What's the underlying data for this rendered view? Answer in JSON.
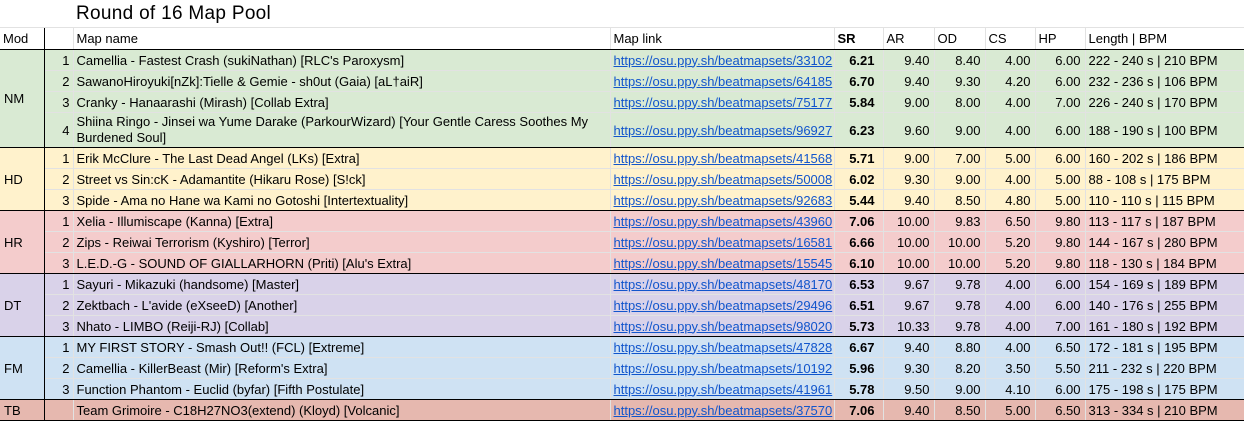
{
  "title": "Round of 16 Map Pool",
  "headers": {
    "mod": "Mod",
    "map_name": "Map name",
    "map_link": "Map link",
    "sr": "SR",
    "ar": "AR",
    "od": "OD",
    "cs": "CS",
    "hp": "HP",
    "length_bpm": "Length | BPM"
  },
  "colors": {
    "NM": "#d9ead3",
    "HD": "#fff2cc",
    "HR": "#f4cccc",
    "DT": "#d9d2e9",
    "FM": "#cfe2f3",
    "TB": "#e6b8af"
  },
  "groups": [
    {
      "mod": "NM",
      "rows": [
        {
          "num": "1",
          "name": "Camellia - Fastest Crash (sukiNathan) [RLC's Paroxysm]",
          "link": "https://osu.ppy.sh/beatmapsets/33102",
          "sr": "6.21",
          "ar": "9.40",
          "od": "8.40",
          "cs": "4.00",
          "hp": "6.00",
          "len": "222 - 240 s | 210 BPM"
        },
        {
          "num": "2",
          "name": "SawanoHiroyuki[nZk]:Tielle & Gemie - sh0ut (Gaia) [aL†aiR]",
          "link": "https://osu.ppy.sh/beatmapsets/64185",
          "sr": "6.70",
          "ar": "9.40",
          "od": "9.30",
          "cs": "4.20",
          "hp": "6.00",
          "len": "232 - 236 s | 106 BPM"
        },
        {
          "num": "3",
          "name": "Cranky - Hanaarashi (Mirash) [Collab Extra]",
          "link": "https://osu.ppy.sh/beatmapsets/75177",
          "sr": "5.84",
          "ar": "9.00",
          "od": "8.00",
          "cs": "4.00",
          "hp": "7.00",
          "len": "226 - 240 s | 170 BPM"
        },
        {
          "num": "4",
          "name": "Shiina Ringo - Jinsei wa Yume Darake (ParkourWizard) [Your Gentle Caress Soothes My Burdened Soul]",
          "link": "https://osu.ppy.sh/beatmapsets/96927",
          "sr": "6.23",
          "ar": "9.60",
          "od": "9.00",
          "cs": "4.00",
          "hp": "6.00",
          "len": "188 - 190 s | 100 BPM",
          "tall": true
        }
      ]
    },
    {
      "mod": "HD",
      "rows": [
        {
          "num": "1",
          "name": "Erik McClure - The Last Dead Angel (LKs) [Extra]",
          "link": "https://osu.ppy.sh/beatmapsets/41568",
          "sr": "5.71",
          "ar": "9.00",
          "od": "7.00",
          "cs": "5.00",
          "hp": "6.00",
          "len": "160 - 202 s | 186 BPM"
        },
        {
          "num": "2",
          "name": "Street vs Sin:cK - Adamantite (Hikaru Rose) [S!ck]",
          "link": "https://osu.ppy.sh/beatmapsets/50008",
          "sr": "6.02",
          "ar": "9.30",
          "od": "9.00",
          "cs": "4.00",
          "hp": "5.00",
          "len": "88 - 108 s | 175 BPM"
        },
        {
          "num": "3",
          "name": "Spide - Ama no Hane wa Kami no Gotoshi [Intertextuality]",
          "link": "https://osu.ppy.sh/beatmapsets/92683",
          "sr": "5.44",
          "ar": "9.40",
          "od": "8.50",
          "cs": "4.80",
          "hp": "5.00",
          "len": "110 - 110 s | 115 BPM"
        }
      ]
    },
    {
      "mod": "HR",
      "rows": [
        {
          "num": "1",
          "name": "Xelia - Illumiscape (Kanna) [Extra]",
          "link": "https://osu.ppy.sh/beatmapsets/43960",
          "sr": "7.06",
          "ar": "10.00",
          "od": "9.83",
          "cs": "6.50",
          "hp": "9.80",
          "len": "113 - 117 s | 187 BPM"
        },
        {
          "num": "2",
          "name": "Zips - Reiwai Terrorism (Kyshiro) [Terror]",
          "link": "https://osu.ppy.sh/beatmapsets/16581",
          "sr": "6.66",
          "ar": "10.00",
          "od": "10.00",
          "cs": "5.20",
          "hp": "9.80",
          "len": "144 - 167 s | 280 BPM"
        },
        {
          "num": "3",
          "name": "L.E.D.-G - SOUND OF GIALLARHORN (Priti) [Alu's Extra]",
          "link": "https://osu.ppy.sh/beatmapsets/15545",
          "sr": "6.10",
          "ar": "10.00",
          "od": "10.00",
          "cs": "5.20",
          "hp": "9.80",
          "len": "118 - 130 s | 184 BPM"
        }
      ]
    },
    {
      "mod": "DT",
      "rows": [
        {
          "num": "1",
          "name": "Sayuri - Mikazuki (handsome) [Master]",
          "link": "https://osu.ppy.sh/beatmapsets/48170",
          "sr": "6.53",
          "ar": "9.67",
          "od": "9.78",
          "cs": "4.00",
          "hp": "6.00",
          "len": "154 - 169 s | 189 BPM"
        },
        {
          "num": "2",
          "name": "Zektbach - L'avide (eXseeD) [Another]",
          "link": "https://osu.ppy.sh/beatmapsets/29496",
          "sr": "6.51",
          "ar": "9.67",
          "od": "9.78",
          "cs": "4.00",
          "hp": "6.00",
          "len": "140 - 176 s | 255 BPM"
        },
        {
          "num": "3",
          "name": "Nhato - LIMBO (Reiji-RJ) [Collab]",
          "link": "https://osu.ppy.sh/beatmapsets/98020",
          "sr": "5.73",
          "ar": "10.33",
          "od": "9.78",
          "cs": "4.00",
          "hp": "7.00",
          "len": "161 - 180 s | 192 BPM"
        }
      ]
    },
    {
      "mod": "FM",
      "rows": [
        {
          "num": "1",
          "name": "MY FIRST STORY - Smash Out!! (FCL) [Extreme]",
          "link": "https://osu.ppy.sh/beatmapsets/47828",
          "sr": "6.67",
          "ar": "9.40",
          "od": "8.80",
          "cs": "4.00",
          "hp": "6.50",
          "len": "172 - 181 s | 195 BPM"
        },
        {
          "num": "2",
          "name": "Camellia - KillerBeast (Mir) [Reform's Extra]",
          "link": "https://osu.ppy.sh/beatmapsets/10192",
          "sr": "5.96",
          "ar": "9.30",
          "od": "8.20",
          "cs": "3.50",
          "hp": "5.50",
          "len": "211 - 232 s | 220 BPM"
        },
        {
          "num": "3",
          "name": "Function Phantom - Euclid (byfar) [Fifth Postulate]",
          "link": "https://osu.ppy.sh/beatmapsets/41961",
          "sr": "5.78",
          "ar": "9.50",
          "od": "9.00",
          "cs": "4.10",
          "hp": "6.00",
          "len": "175 - 198 s | 175 BPM"
        }
      ]
    },
    {
      "mod": "TB",
      "rows": [
        {
          "num": "",
          "name": "Team Grimoire - C18H27NO3(extend) (Kloyd) [Volcanic]",
          "link": "https://osu.ppy.sh/beatmapsets/37570",
          "sr": "7.06",
          "ar": "9.40",
          "od": "8.50",
          "cs": "5.00",
          "hp": "6.50",
          "len": "313 - 334 s | 210 BPM"
        }
      ]
    }
  ]
}
